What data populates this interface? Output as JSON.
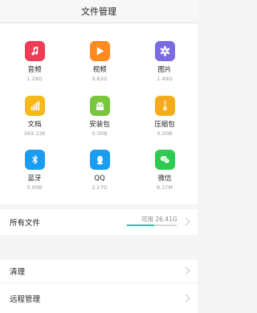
{
  "header": {
    "title": "文件管理"
  },
  "categories": [
    {
      "name": "音频",
      "size": "1.28G",
      "icon": "music-note-icon",
      "color": "#ee3c56"
    },
    {
      "name": "视频",
      "size": "9.62G",
      "icon": "play-icon",
      "color": "#ff8a1f"
    },
    {
      "name": "图片",
      "size": "1.49G",
      "icon": "pinwheel-icon",
      "color": "#7b6be3"
    },
    {
      "name": "文档",
      "size": "369.33K",
      "icon": "bar-chart-icon",
      "color": "#f6b81a"
    },
    {
      "name": "安装包",
      "size": "0.00B",
      "icon": "android-icon",
      "color": "#79c63d"
    },
    {
      "name": "压缩包",
      "size": "0.00B",
      "icon": "zipper-icon",
      "color": "#f5ac1c"
    },
    {
      "name": "蓝牙",
      "size": "0.00B",
      "icon": "bluetooth-icon",
      "color": "#1a9cf0"
    },
    {
      "name": "QQ",
      "size": "2.27G",
      "icon": "qq-icon",
      "color": "#1a9cf0"
    },
    {
      "name": "微信",
      "size": "8.37M",
      "icon": "wechat-icon",
      "color": "#2ecb53"
    }
  ],
  "all_files": {
    "label": "所有文件",
    "storage_text": "可用 26.41G",
    "used_fraction": 0.55
  },
  "menu": {
    "clean_label": "清理",
    "remote_label": "远程管理"
  },
  "colors": {
    "accent": "#1fc9a7"
  }
}
